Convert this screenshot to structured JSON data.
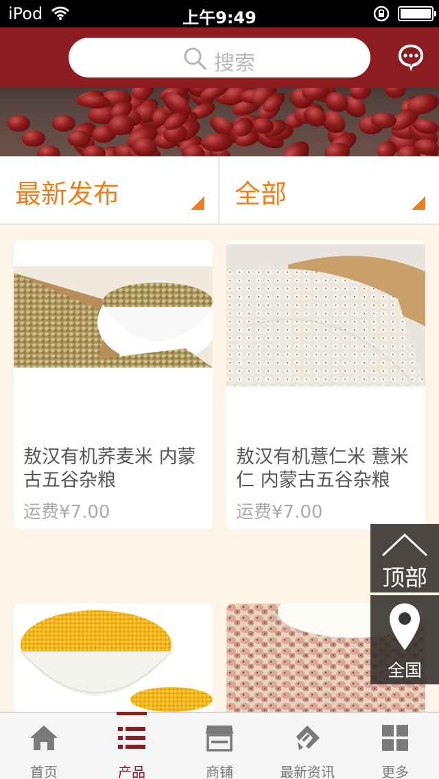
{
  "status_bar": {
    "carrier": "iPod",
    "time": "上午9:49"
  },
  "header": {
    "search_placeholder": "搜索",
    "icons": [
      "search-icon",
      "message-icon"
    ]
  },
  "filters": [
    {
      "label": "最新发布"
    },
    {
      "label": "全部"
    }
  ],
  "products": [
    {
      "name": "敖汉有机荞麦米 内蒙古五谷杂粮",
      "price": "运费¥7.00"
    },
    {
      "name": "敖汉有机薏仁米 薏米仁 内蒙古五谷杂粮",
      "price": "运费¥7.00"
    },
    {
      "name": "",
      "price": ""
    },
    {
      "name": "",
      "price": ""
    }
  ],
  "floating": {
    "top_label": "顶部",
    "region_label": "全国"
  },
  "tabs": [
    {
      "label": "首页",
      "icon": "home-icon"
    },
    {
      "label": "产品",
      "icon": "list-icon",
      "active": true
    },
    {
      "label": "商铺",
      "icon": "store-icon"
    },
    {
      "label": "最新资讯",
      "icon": "news-icon"
    },
    {
      "label": "更多",
      "icon": "grid-icon"
    }
  ],
  "colors": {
    "brand": "#8e1d22",
    "accent": "#ee7f1b",
    "background": "#fdf3e6"
  }
}
